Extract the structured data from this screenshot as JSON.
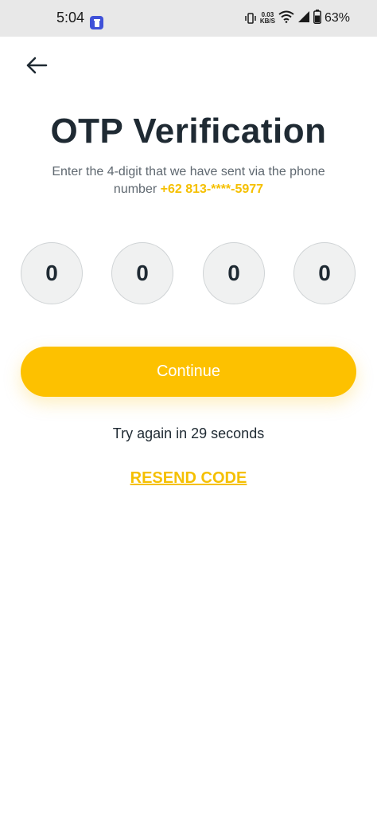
{
  "status_bar": {
    "time": "5:04",
    "net_speed_value": "0.03",
    "net_speed_unit": "KB/S",
    "battery": "63%",
    "icons": [
      "app-notification-icon",
      "vibrate-icon",
      "wifi-icon",
      "signal-icon",
      "battery-icon"
    ]
  },
  "header": {
    "back_icon": "arrow-left-icon",
    "title": "OTP Verification"
  },
  "subtitle": {
    "text": "Enter the 4-digit that we have sent via the phone number",
    "phone": "+62 813-****-5977"
  },
  "otp": {
    "digits": [
      "0",
      "0",
      "0",
      "0"
    ]
  },
  "actions": {
    "continue_label": "Continue",
    "retry_text": "Try again in 29 seconds",
    "resend_label": "RESEND CODE"
  },
  "colors": {
    "accent": "#fdc100",
    "title": "#1f2a33",
    "status_bar_bg": "#e8e8e8"
  }
}
